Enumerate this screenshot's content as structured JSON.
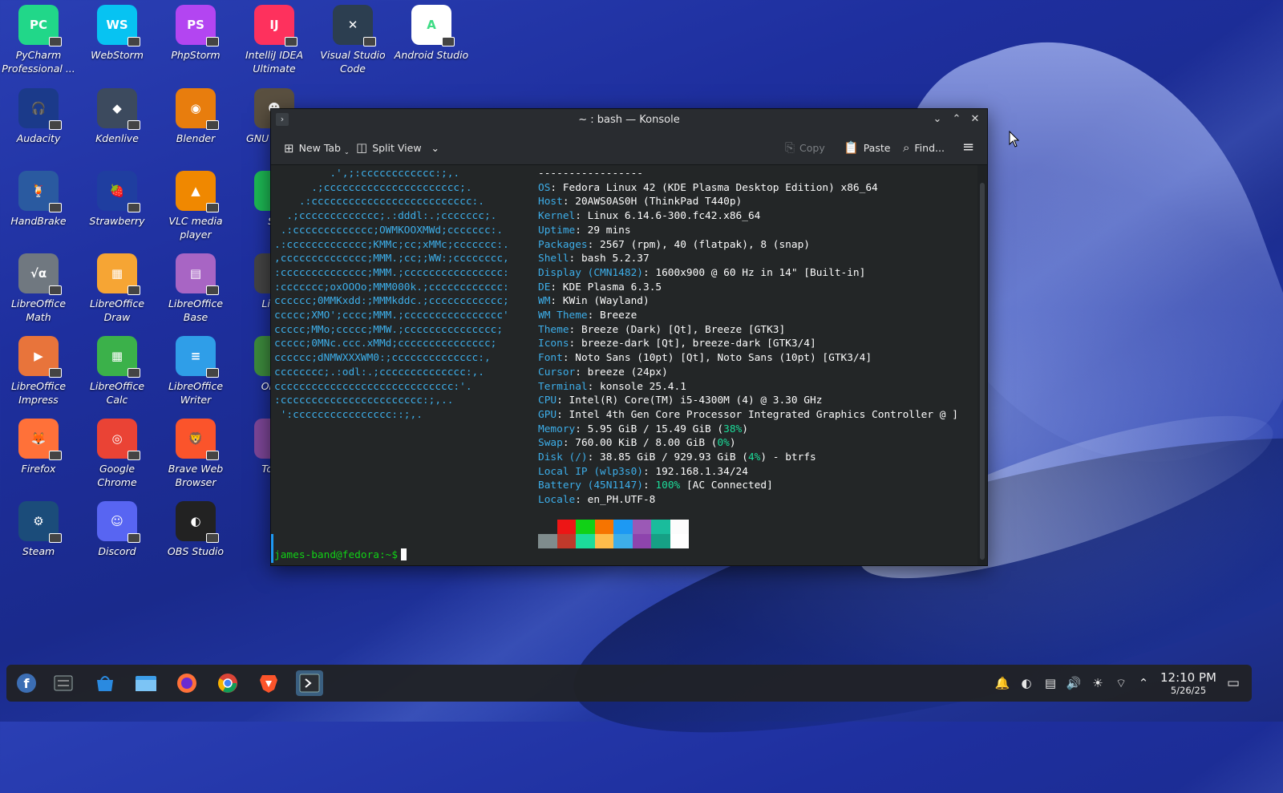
{
  "desktop": {
    "icons": [
      {
        "label": "PyCharm Professional ...",
        "abbr": "PC",
        "color": "#21d789"
      },
      {
        "label": "WebStorm",
        "abbr": "WS",
        "color": "#07c3f2"
      },
      {
        "label": "PhpStorm",
        "abbr": "PS",
        "color": "#b345f1"
      },
      {
        "label": "IntelliJ IDEA Ultimate",
        "abbr": "IJ",
        "color": "#fe315d"
      },
      {
        "label": "Visual Studio Code",
        "abbr": "✕",
        "color": "#2c3e50"
      },
      {
        "label": "Android Studio",
        "abbr": "A",
        "color": "#ffffff"
      },
      {
        "label": "Audacity",
        "abbr": "🎧",
        "color": "#1b3a8a"
      },
      {
        "label": "Kdenlive",
        "abbr": "◆",
        "color": "#3c4a5e"
      },
      {
        "label": "Blender",
        "abbr": "◉",
        "color": "#e87d0d"
      },
      {
        "label": "GNU Manip",
        "abbr": "☻",
        "color": "#5a5040"
      },
      {
        "label": "HandBrake",
        "abbr": "🍹",
        "color": "#2a5aa0"
      },
      {
        "label": "Strawberry",
        "abbr": "🍓",
        "color": "#1f3ea0"
      },
      {
        "label": "VLC media player",
        "abbr": "▲",
        "color": "#f08800"
      },
      {
        "label": "Sp",
        "abbr": "S",
        "color": "#1db954"
      },
      {
        "label": "LibreOffice Math",
        "abbr": "√α",
        "color": "#707880"
      },
      {
        "label": "LibreOffice Draw",
        "abbr": "▦",
        "color": "#f6a534"
      },
      {
        "label": "LibreOffice Base",
        "abbr": "▤",
        "color": "#a865c4"
      },
      {
        "label": "Libre",
        "abbr": "",
        "color": "#444"
      },
      {
        "label": "LibreOffice Impress",
        "abbr": "▶",
        "color": "#e8743b"
      },
      {
        "label": "LibreOffice Calc",
        "abbr": "▦",
        "color": "#3bb14a"
      },
      {
        "label": "LibreOffice Writer",
        "abbr": "≡",
        "color": "#2f9ee8"
      },
      {
        "label": "ONLY",
        "abbr": "",
        "color": "#3d8b3d"
      },
      {
        "label": "Firefox",
        "abbr": "🦊",
        "color": "#ff7139"
      },
      {
        "label": "Google Chrome",
        "abbr": "◎",
        "color": "#ea4335"
      },
      {
        "label": "Brave Web Browser",
        "abbr": "🦁",
        "color": "#fb542b"
      },
      {
        "label": "Tor B",
        "abbr": "",
        "color": "#7d4698"
      },
      {
        "label": "Steam",
        "abbr": "⚙",
        "color": "#1b4c7a"
      },
      {
        "label": "Discord",
        "abbr": "☺",
        "color": "#5865f2"
      },
      {
        "label": "OBS Studio",
        "abbr": "◐",
        "color": "#222"
      }
    ]
  },
  "konsole": {
    "title": "~ : bash — Konsole",
    "toolbar": {
      "new_tab": "New Tab",
      "split_view": "Split View",
      "copy": "Copy",
      "paste": "Paste",
      "find": "Find..."
    },
    "logo_lines": [
      "         .',;:cccccccccccc:;,.",
      "      .;cccccccccccccccccccccc;.",
      "    .:cccccccccccccccccccccccccc:.",
      "  .;ccccccccccccc;.:dddl:.;ccccccc;.",
      " .:ccccccccccccc;OWMKOOXMWd;ccccccc:.",
      ".:ccccccccccccc;KMMc;cc;xMMc;ccccccc:.",
      ",cccccccccccccc;MMM.;cc;;WW:;cccccccc,",
      ":cccccccccccccc;MMM.;cccccccccccccccc:",
      ":ccccccc;oxOOOo;MMM000k.;cccccccccccc:",
      "cccccc;0MMKxdd:;MMMkddc.;cccccccccccc;",
      "ccccc;XMO';cccc;MMM.;cccccccccccccccc'",
      "ccccc;MMo;ccccc;MMW.;ccccccccccccccc;",
      "ccccc;0MNc.ccc.xMMd;ccccccccccccccc;",
      "cccccc;dNMWXXXWM0:;cccccccccccccc:,",
      "cccccccc;.:odl:.;cccccccccccccc:,.",
      "ccccccccccccccccccccccccccccc:'.",
      ":ccccccccccccccccccccccc:;,..",
      " ':cccccccccccccccc::;,."
    ],
    "separator": "-----------------",
    "info": [
      {
        "key": "OS",
        "value": "Fedora Linux 42 (KDE Plasma Desktop Edition) x86_64"
      },
      {
        "key": "Host",
        "value": "20AWS0AS0H (ThinkPad T440p)"
      },
      {
        "key": "Kernel",
        "value": "Linux 6.14.6-300.fc42.x86_64"
      },
      {
        "key": "Uptime",
        "value": "29 mins"
      },
      {
        "key": "Packages",
        "value": "2567 (rpm), 40 (flatpak), 8 (snap)"
      },
      {
        "key": "Shell",
        "value": "bash 5.2.37"
      },
      {
        "key": "Display (CMN1482)",
        "value": "1600x900 @ 60 Hz in 14\" [Built-in]"
      },
      {
        "key": "DE",
        "value": "KDE Plasma 6.3.5"
      },
      {
        "key": "WM",
        "value": "KWin (Wayland)"
      },
      {
        "key": "WM Theme",
        "value": "Breeze"
      },
      {
        "key": "Theme",
        "value": "Breeze (Dark) [Qt], Breeze [GTK3]"
      },
      {
        "key": "Icons",
        "value": "breeze-dark [Qt], breeze-dark [GTK3/4]"
      },
      {
        "key": "Font",
        "value": "Noto Sans (10pt) [Qt], Noto Sans (10pt) [GTK3/4]"
      },
      {
        "key": "Cursor",
        "value": "breeze (24px)"
      },
      {
        "key": "Terminal",
        "value": "konsole 25.4.1"
      },
      {
        "key": "CPU",
        "value": "Intel(R) Core(TM) i5-4300M (4) @ 3.30 GHz"
      },
      {
        "key": "GPU",
        "value": "Intel 4th Gen Core Processor Integrated Graphics Controller @ ]"
      },
      {
        "key": "Memory",
        "value": "5.95 GiB / 15.49 GiB (",
        "pct": "38%",
        "tail": ")"
      },
      {
        "key": "Swap",
        "value": "760.00 KiB / 8.00 GiB (",
        "pct": "0%",
        "tail": ")"
      },
      {
        "key": "Disk (/)",
        "value": "38.85 GiB / 929.93 GiB (",
        "pct": "4%",
        "tail": ") - btrfs"
      },
      {
        "key": "Local IP (wlp3s0)",
        "value": "192.168.1.34/24"
      },
      {
        "key": "Battery (45N1147)",
        "value": "",
        "pct": "100%",
        "tail": " [AC Connected]"
      },
      {
        "key": "Locale",
        "value": "en_PH.UTF-8"
      }
    ],
    "palette_top": [
      "#232627",
      "#ed1515",
      "#11d116",
      "#f67400",
      "#1d99f3",
      "#9b59b6",
      "#1abc9c",
      "#fcfcfc"
    ],
    "palette_bottom": [
      "#7f8c8d",
      "#c0392b",
      "#1cdc9a",
      "#fdbc4b",
      "#3daee9",
      "#8e44ad",
      "#16a085",
      "#ffffff"
    ],
    "prompt": "james-band@fedora:~$"
  },
  "taskbar": {
    "apps": [
      "fedora-launcher-icon",
      "system-settings-icon",
      "discover-store-icon",
      "dolphin-files-icon",
      "firefox-icon",
      "chrome-icon",
      "brave-icon",
      "konsole-icon"
    ],
    "clock_time": "12:10 PM",
    "clock_date": "5/26/25"
  }
}
